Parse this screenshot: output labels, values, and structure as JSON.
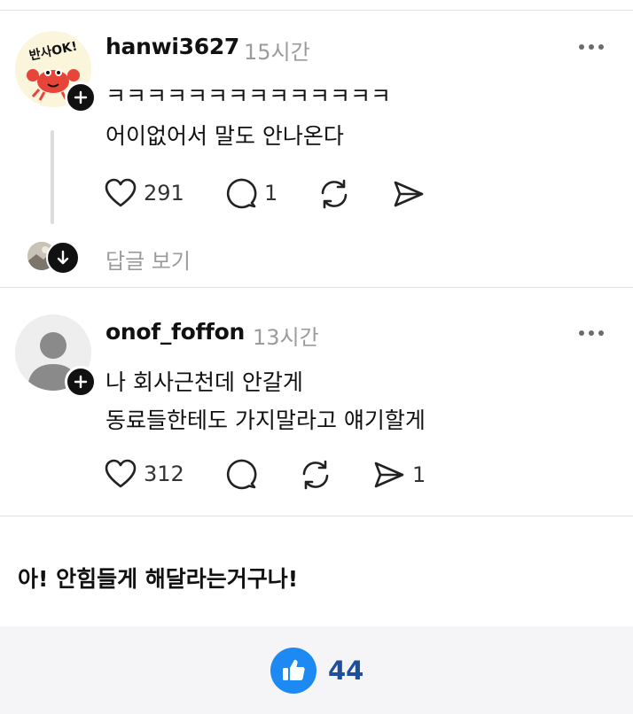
{
  "posts": [
    {
      "username": "hanwi3627",
      "time": "15시간",
      "avatar_text": "반사OK!",
      "lines": [
        "ㅋㅋㅋㅋㅋㅋㅋㅋㅋㅋㅋㅋㅋㅋ",
        "어이없어서 말도 안나온다"
      ],
      "likes": "291",
      "comments": "1",
      "view_replies": "답글 보기"
    },
    {
      "username": "onof_foffon",
      "time": "13시간",
      "lines": [
        "나 회사근천데 안갈게",
        "동료들한테도 가지말라고 얘기할게"
      ],
      "likes": "312",
      "shares": "1"
    }
  ],
  "comment_text": "아! 안힘들게 해달라는거구나!",
  "footer": {
    "like_count": "44"
  },
  "colors": {
    "accent": "#1d89f2",
    "like_count": "#1d4f9a",
    "muted": "#9b9b9b"
  }
}
